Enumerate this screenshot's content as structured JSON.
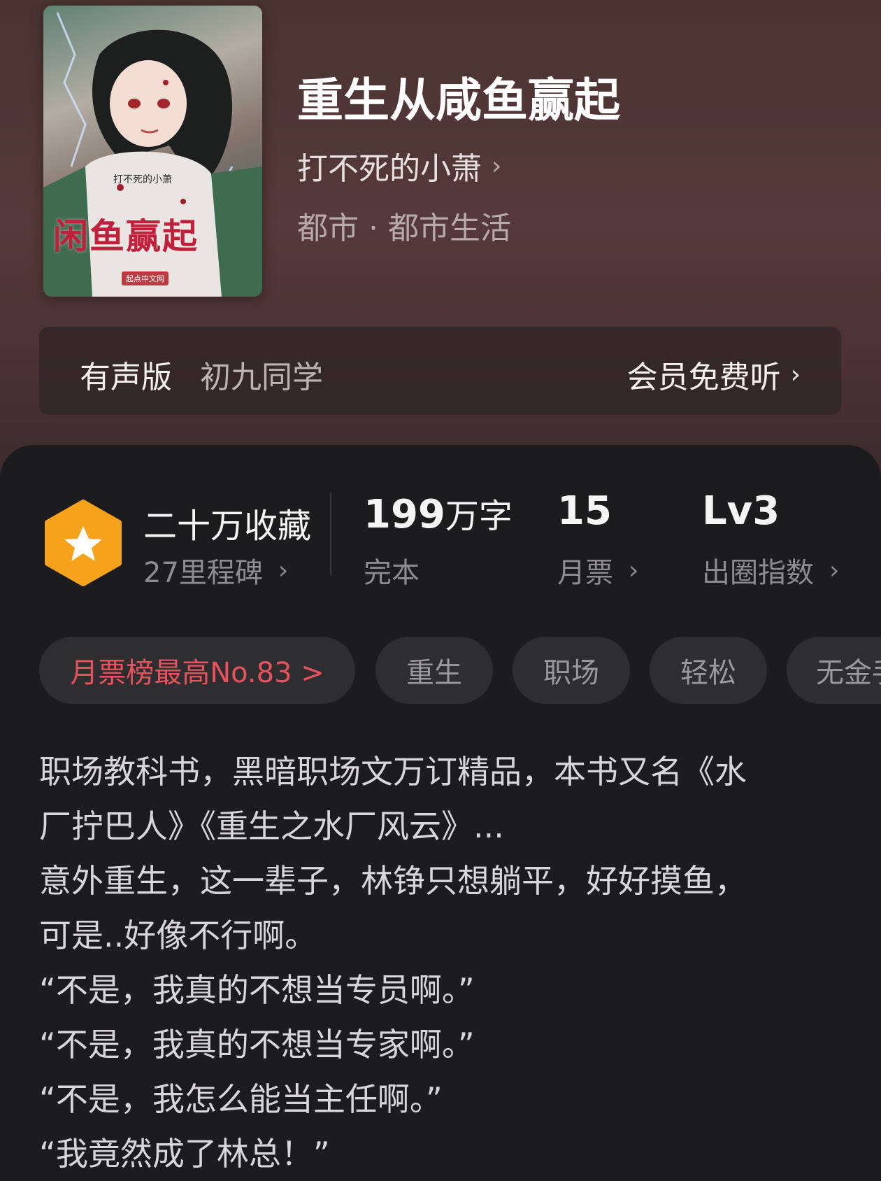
{
  "book": {
    "title": "重生从咸鱼赢起",
    "author": "打不死的小萧",
    "genre": "都市 · 都市生活",
    "cover": {
      "title_art": "闲鱼赢起",
      "author_art": "打不死的小萧",
      "publisher_art": "起点中文网"
    }
  },
  "audio": {
    "label": "有声版",
    "narrator": "初九同学",
    "cta": "会员免费听"
  },
  "stats": {
    "collection": "二十万收藏",
    "milestone": "27里程碑",
    "words_num": "199",
    "words_unit": "万字",
    "status": "完本",
    "monthly_votes": "15",
    "monthly_votes_label": "月票",
    "level": "Lv3",
    "level_label": "出圈指数"
  },
  "tags": [
    "月票榜最高No.83 >",
    "重生",
    "职场",
    "轻松",
    "无金手"
  ],
  "description": [
    "职场教科书，黑暗职场文万订精品，本书又名《水",
    "厂拧巴人》《重生之水厂风云》...",
    "意外重生，这一辈子，林铮只想躺平，好好摸鱼，",
    "可是..好像不行啊。",
    "“不是，我真的不想当专员啊。”",
    "“不是，我真的不想当专家啊。”",
    "“不是，我怎么能当主任啊。”",
    "“我竟然成了林总！”"
  ],
  "colors": {
    "accent_rank": "#e8525c",
    "badge_orange": "#f7a21b",
    "sheet_bg": "#1c1b1d"
  },
  "icons": {
    "chevron": "chevron-right-icon",
    "badge": "star-hexagon-icon"
  }
}
